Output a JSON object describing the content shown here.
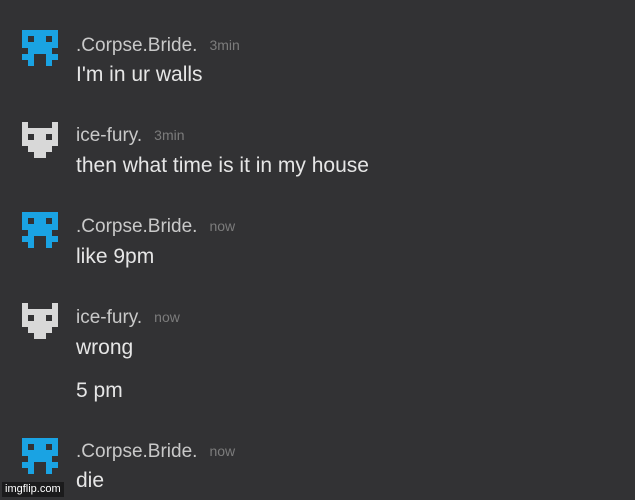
{
  "colors": {
    "background": "#323234",
    "corpse_avatar": "#1aa3e3",
    "ice_avatar": "#d8d8d8",
    "username": "#c9c9c9",
    "timestamp": "#7c7c7c",
    "message_text": "#e6e6e6"
  },
  "messages": [
    {
      "author": ".Corpse.Bride.",
      "time": "3min",
      "lines": [
        "I'm in ur walls"
      ],
      "avatar": "corpse-bride-avatar-icon"
    },
    {
      "author": "ice-fury.",
      "time": "3min",
      "lines": [
        "then what time is it in my house"
      ],
      "avatar": "ice-fury-avatar-icon"
    },
    {
      "author": ".Corpse.Bride.",
      "time": "now",
      "lines": [
        "like 9pm"
      ],
      "avatar": "corpse-bride-avatar-icon"
    },
    {
      "author": "ice-fury.",
      "time": "now",
      "lines": [
        "wrong",
        "5 pm"
      ],
      "avatar": "ice-fury-avatar-icon"
    },
    {
      "author": ".Corpse.Bride.",
      "time": "now",
      "lines": [
        "die"
      ],
      "avatar": "corpse-bride-avatar-icon"
    }
  ],
  "watermark": "imgflip.com"
}
